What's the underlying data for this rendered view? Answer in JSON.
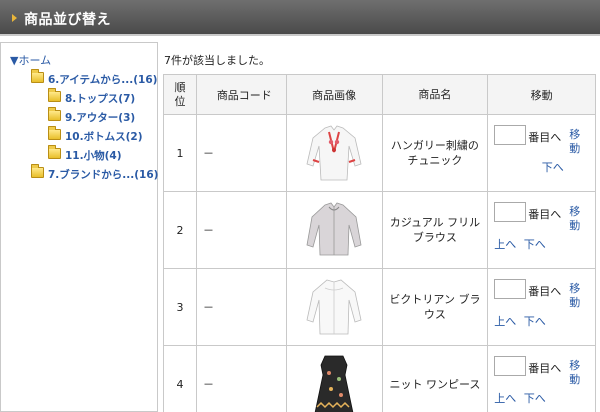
{
  "header": {
    "title": "商品並び替え"
  },
  "sidebar": {
    "root": "▼ホーム",
    "items": [
      {
        "label": "6.アイテムから...(16)"
      },
      {
        "label": "8.トップス(7)"
      },
      {
        "label": "9.アウター(3)"
      },
      {
        "label": "10.ボトムス(2)"
      },
      {
        "label": "11.小物(4)"
      },
      {
        "label": "7.ブランドから...(16)"
      }
    ]
  },
  "main": {
    "result_count": "7件が該当しました。",
    "columns": [
      "順位",
      "商品コード",
      "商品画像",
      "商品名",
      "移動"
    ],
    "rows": [
      {
        "rank": "1",
        "code": "－",
        "name": "ハンガリー刺繍のチュニック",
        "image_icon": "white-embroidered-tunic-image"
      },
      {
        "rank": "2",
        "code": "－",
        "name": "カジュアル フリル ブラウス",
        "image_icon": "gray-frill-blouse-image"
      },
      {
        "rank": "3",
        "code": "－",
        "name": "ビクトリアン ブラウス",
        "image_icon": "white-victorian-blouse-image"
      },
      {
        "rank": "4",
        "code": "－",
        "name": "ニット ワンピース",
        "image_icon": "black-knit-dress-image"
      }
    ],
    "move": {
      "suffix": "番目へ",
      "move_label": "移動",
      "up_label": "上へ",
      "down_label": "下へ"
    }
  }
}
